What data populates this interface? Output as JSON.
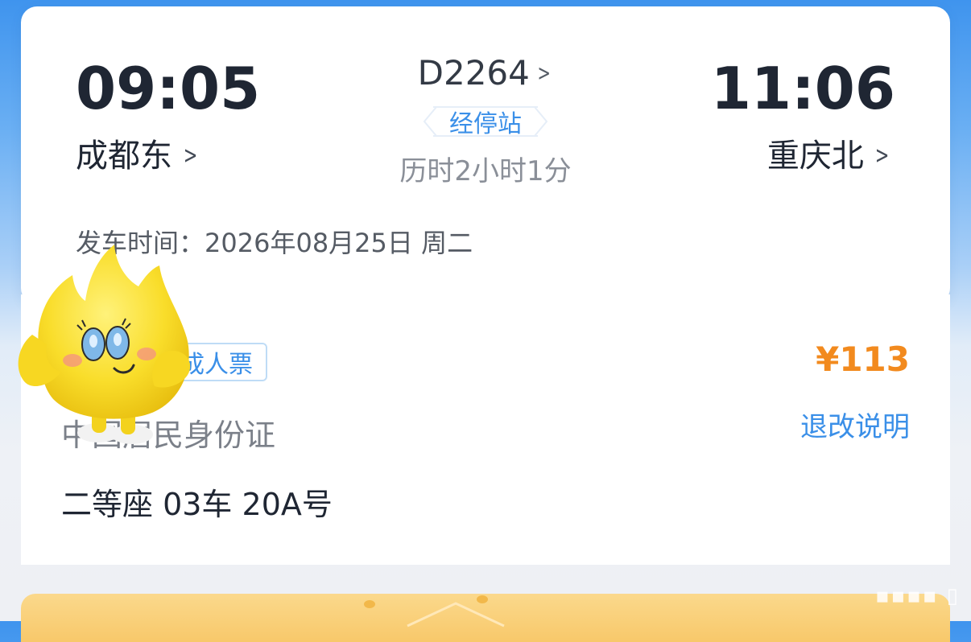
{
  "trip": {
    "departure_time": "09:05",
    "departure_station": "成都东",
    "train_number": "D2264",
    "stop_tag": "经停站",
    "duration": "历时2小时1分",
    "arrival_time": "11:06",
    "arrival_station": "重庆北",
    "departure_date_label": "发车时间：",
    "departure_date": "2026年08月25日 周二"
  },
  "passenger": {
    "ticket_type": "成人票",
    "price": "¥113",
    "refund_link": "退改说明",
    "id_type": "中国居民身份证",
    "seat": "二等座 03车 20A号"
  },
  "colors": {
    "accent": "#3a8fe8",
    "price": "#f28a1e",
    "background_top": "#3f94ee"
  },
  "icons": {
    "chevron": "chevron-right-icon",
    "mascot": "mascot-sticker"
  }
}
